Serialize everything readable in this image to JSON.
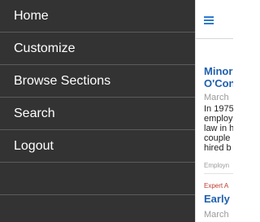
{
  "drawer": {
    "items": [
      {
        "label": "Home"
      },
      {
        "label": "Customize"
      },
      {
        "label": "Browse Sections"
      },
      {
        "label": "Search"
      },
      {
        "label": "Logout"
      }
    ]
  },
  "main": {
    "articles": [
      {
        "title_line1": "Minori",
        "title_line2": "O'Con",
        "date": "March",
        "body": [
          "In 1975",
          "employ",
          "law in h",
          "couple",
          "hired b"
        ],
        "category": "Employn"
      },
      {
        "label": "Expert A",
        "title": "Early l",
        "date": "March"
      }
    ]
  },
  "colors": {
    "drawer_bg": "#333333",
    "link_blue": "#1f5fae",
    "label_red": "#c0392b"
  },
  "icons": {
    "menu": "hamburger-icon"
  }
}
